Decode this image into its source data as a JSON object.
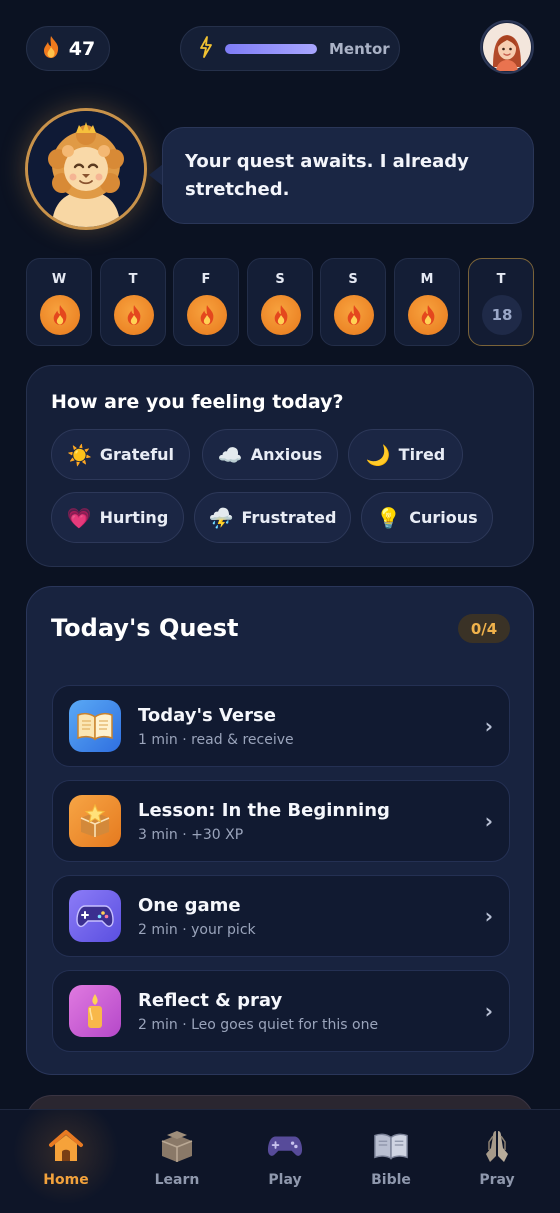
{
  "header": {
    "streak_count": "47",
    "mentor_label": "Mentor",
    "mentor_progress": 0.78,
    "icons": [
      "flame-icon",
      "lightning-icon",
      "avatar"
    ]
  },
  "mascot": {
    "speech": "Your quest awaits. I already stretched."
  },
  "week": [
    {
      "label": "W",
      "state": "done"
    },
    {
      "label": "T",
      "state": "done"
    },
    {
      "label": "F",
      "state": "done"
    },
    {
      "label": "S",
      "state": "done"
    },
    {
      "label": "S",
      "state": "done"
    },
    {
      "label": "M",
      "state": "done"
    },
    {
      "label": "T",
      "state": "today",
      "date": "18"
    }
  ],
  "mood": {
    "question": "How are you feeling today?",
    "options": [
      {
        "emoji": "☀️",
        "label": "Grateful"
      },
      {
        "emoji": "☁️",
        "label": "Anxious"
      },
      {
        "emoji": "🌙",
        "label": "Tired"
      },
      {
        "emoji": "💗",
        "label": "Hurting"
      },
      {
        "emoji": "⛈️",
        "label": "Frustrated"
      },
      {
        "emoji": "💡",
        "label": "Curious"
      }
    ]
  },
  "quest": {
    "title": "Today's Quest",
    "progress": "0/4",
    "items": [
      {
        "title": "Today's Verse",
        "subtitle": "1 min · read & receive",
        "icon": "open-book-icon"
      },
      {
        "title": "Lesson: In the Beginning",
        "subtitle": "3 min · +30 XP",
        "icon": "lesson-box-icon"
      },
      {
        "title": "One game",
        "subtitle": "2 min · your pick",
        "icon": "gamepad-icon"
      },
      {
        "title": "Reflect & pray",
        "subtitle": "2 min · Leo goes quiet for this one",
        "icon": "candle-icon"
      }
    ],
    "chevron": "›"
  },
  "nav": {
    "items": [
      {
        "label": "Home",
        "icon": "home-icon",
        "active": true
      },
      {
        "label": "Learn",
        "icon": "learn-icon",
        "active": false
      },
      {
        "label": "Play",
        "icon": "gamepad-icon",
        "active": false
      },
      {
        "label": "Bible",
        "icon": "bible-icon",
        "active": false
      },
      {
        "label": "Pray",
        "icon": "praying-hands-icon",
        "active": false
      }
    ]
  },
  "colors": {
    "background": "#0b1222",
    "accent_orange": "#f2a23c",
    "mentor_bar": "#8f8dfb",
    "card": "#18233f"
  }
}
